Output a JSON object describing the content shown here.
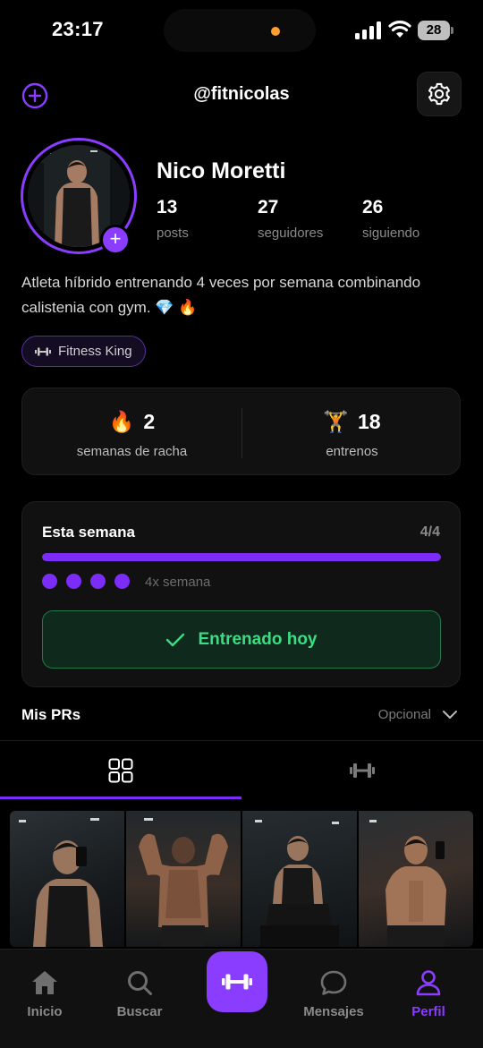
{
  "status_bar": {
    "time": "23:17",
    "battery": "28"
  },
  "header": {
    "handle": "@fitnicolas",
    "add_icon": "plus-circle-icon",
    "settings_icon": "gear-icon"
  },
  "profile": {
    "name": "Nico Moretti",
    "stats": [
      {
        "value": "13",
        "label": "posts"
      },
      {
        "value": "27",
        "label": "seguidores"
      },
      {
        "value": "26",
        "label": "siguiendo"
      }
    ],
    "bio": "Atleta híbrido entrenando 4 veces por semana combinando calistenia con gym. 💎 🔥",
    "badge": "Fitness King"
  },
  "summary": {
    "streak_value": "2",
    "streak_label": "semanas de racha",
    "streak_emoji": "🔥",
    "workouts_value": "18",
    "workouts_label": "entrenos",
    "workouts_emoji": "🏋️"
  },
  "week": {
    "title": "Esta semana",
    "count": "4/4",
    "progress": 1.0,
    "dots_filled": 4,
    "frequency": "4x semana",
    "trained_label": "Entrenado hoy"
  },
  "prs": {
    "title": "Mis PRs",
    "option": "Opcional"
  },
  "tabs": [
    {
      "icon": "grid-icon",
      "active": true
    },
    {
      "icon": "dumbbell-icon",
      "active": false
    }
  ],
  "nav": {
    "home": "Inicio",
    "search": "Buscar",
    "messages": "Mensajes",
    "profile": "Perfil"
  },
  "colors": {
    "accent": "#8b3dff",
    "success": "#3ddc84",
    "background": "#000000"
  }
}
